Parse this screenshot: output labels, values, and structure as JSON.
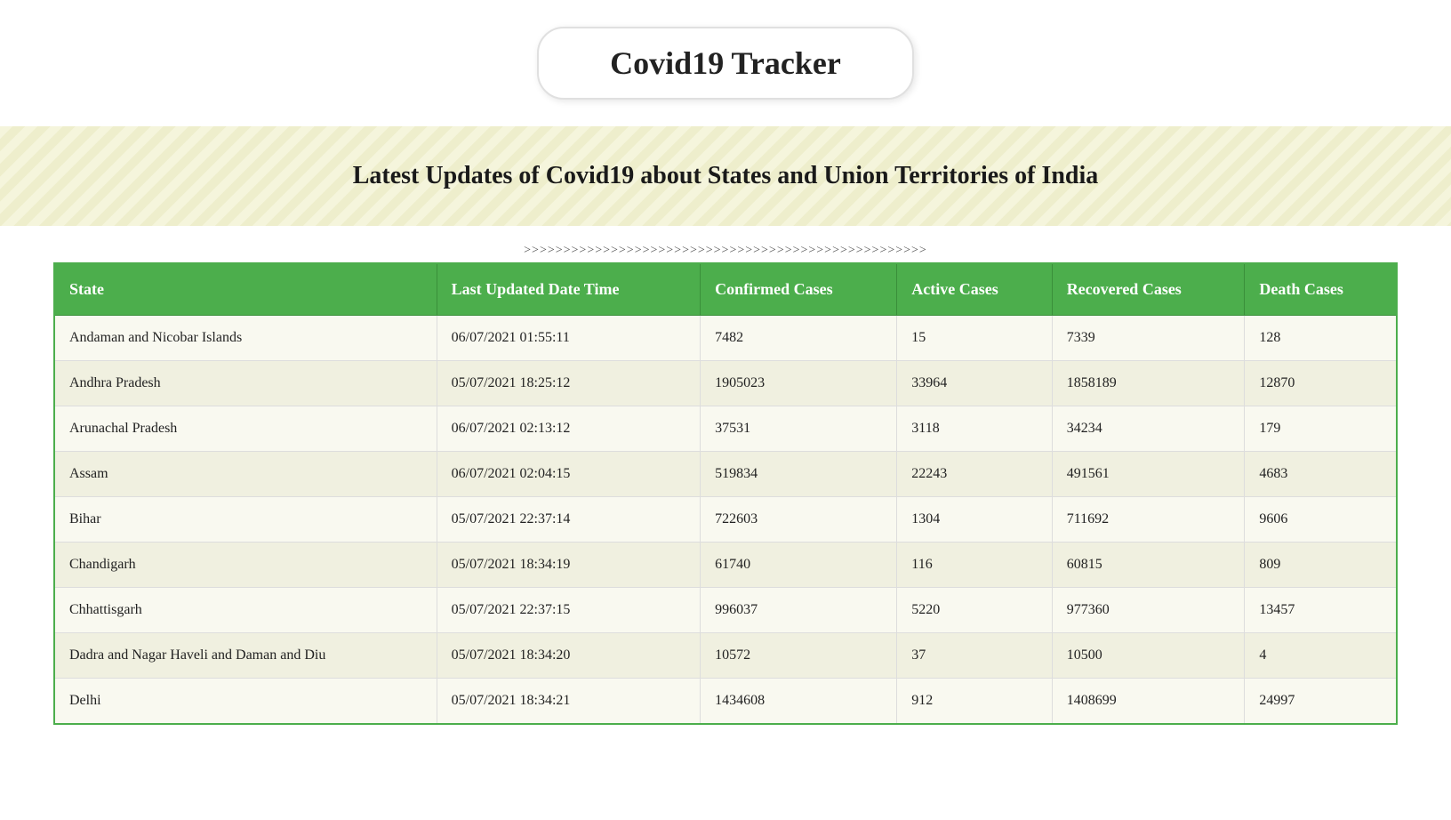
{
  "header": {
    "title": "Covid19 Tracker"
  },
  "banner": {
    "title": "Latest Updates of Covid19 about States and Union Territories of India",
    "arrows": ">>>>>>>>>>>>>>>>>>>>>>>>>>>>>>>>>>>>>>>>>>>>>>>>>>>"
  },
  "table": {
    "columns": [
      "State",
      "Last Updated Date Time",
      "Confirmed Cases",
      "Active Cases",
      "Recovered Cases",
      "Death Cases"
    ],
    "rows": [
      {
        "state": "Andaman and Nicobar Islands",
        "updated": "06/07/2021 01:55:11",
        "confirmed": "7482",
        "active": "15",
        "recovered": "7339",
        "deaths": "128"
      },
      {
        "state": "Andhra Pradesh",
        "updated": "05/07/2021 18:25:12",
        "confirmed": "1905023",
        "active": "33964",
        "recovered": "1858189",
        "deaths": "12870"
      },
      {
        "state": "Arunachal Pradesh",
        "updated": "06/07/2021 02:13:12",
        "confirmed": "37531",
        "active": "3118",
        "recovered": "34234",
        "deaths": "179"
      },
      {
        "state": "Assam",
        "updated": "06/07/2021 02:04:15",
        "confirmed": "519834",
        "active": "22243",
        "recovered": "491561",
        "deaths": "4683"
      },
      {
        "state": "Bihar",
        "updated": "05/07/2021 22:37:14",
        "confirmed": "722603",
        "active": "1304",
        "recovered": "711692",
        "deaths": "9606"
      },
      {
        "state": "Chandigarh",
        "updated": "05/07/2021 18:34:19",
        "confirmed": "61740",
        "active": "116",
        "recovered": "60815",
        "deaths": "809"
      },
      {
        "state": "Chhattisgarh",
        "updated": "05/07/2021 22:37:15",
        "confirmed": "996037",
        "active": "5220",
        "recovered": "977360",
        "deaths": "13457"
      },
      {
        "state": "Dadra and Nagar Haveli and Daman and Diu",
        "updated": "05/07/2021 18:34:20",
        "confirmed": "10572",
        "active": "37",
        "recovered": "10500",
        "deaths": "4"
      },
      {
        "state": "Delhi",
        "updated": "05/07/2021 18:34:21",
        "confirmed": "1434608",
        "active": "912",
        "recovered": "1408699",
        "deaths": "24997"
      }
    ]
  }
}
